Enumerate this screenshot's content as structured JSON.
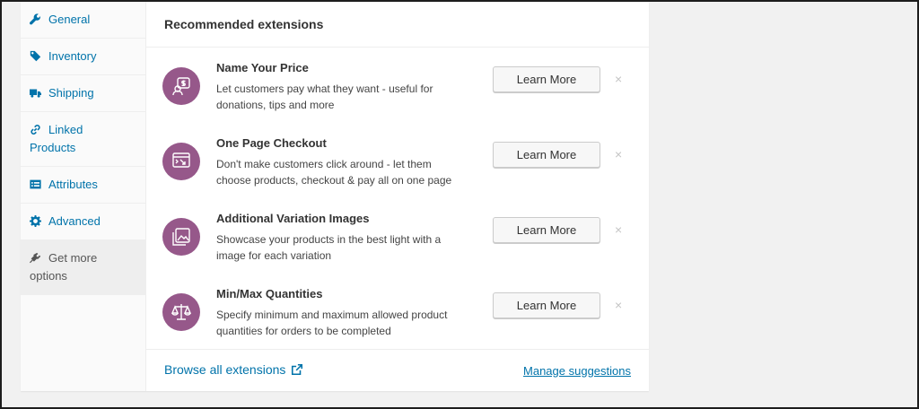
{
  "sidebar": {
    "items": [
      {
        "label": "General",
        "icon": "wrench-icon"
      },
      {
        "label": "Inventory",
        "icon": "tag-icon"
      },
      {
        "label": "Shipping",
        "icon": "truck-icon"
      },
      {
        "label": "Linked",
        "label2": "Products",
        "icon": "link-icon"
      },
      {
        "label": "Attributes",
        "icon": "list-icon"
      },
      {
        "label": "Advanced",
        "icon": "gear-icon"
      },
      {
        "label": "Get more",
        "label2": "options",
        "icon": "plug-icon"
      }
    ],
    "active_index": 6
  },
  "main": {
    "title": "Recommended extensions",
    "extensions": [
      {
        "title": "Name Your Price",
        "desc1": "Let customers pay what they want - useful for",
        "desc2": "donations, tips and more",
        "button": "Learn More",
        "dismiss": "×",
        "icon": "name-your-price-icon"
      },
      {
        "title": "One Page Checkout",
        "desc1": "Don't make customers click around - let them",
        "desc2": "choose products, checkout & pay all on one page",
        "button": "Learn More",
        "dismiss": "×",
        "icon": "one-page-checkout-icon"
      },
      {
        "title": "Additional Variation Images",
        "desc1": "Showcase your products in the best light with a",
        "desc2": "image for each variation",
        "button": "Learn More",
        "dismiss": "×",
        "icon": "variation-images-icon"
      },
      {
        "title": "Min/Max Quantities",
        "desc1": "Specify minimum and maximum allowed product",
        "desc2": "quantities for orders to be completed",
        "button": "Learn More",
        "dismiss": "×",
        "icon": "min-max-quantities-icon"
      }
    ],
    "footer": {
      "browse": "Browse all extensions",
      "manage": "Manage suggestions"
    }
  },
  "colors": {
    "accent": "#0073aa",
    "brand_purple": "#96588a"
  }
}
